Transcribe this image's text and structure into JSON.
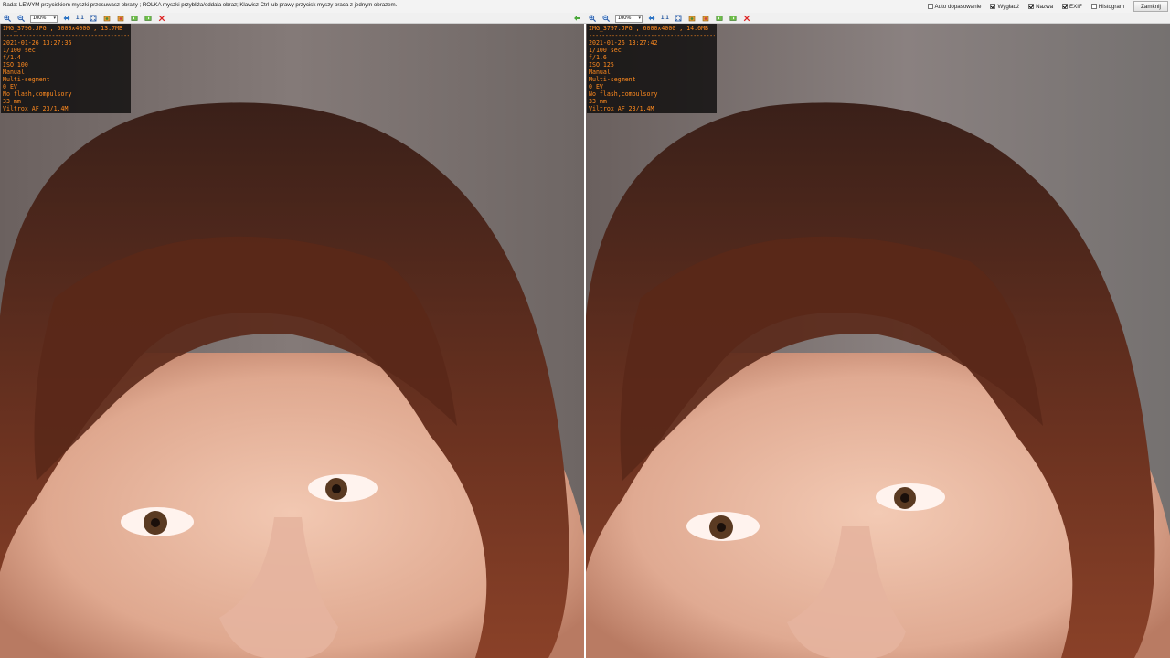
{
  "topbar": {
    "hint": "Rada: LEWYM przyciskiem myszki przesuwasz obrazy ; ROLKA myszki przybliża/oddala obraz; Klawisz Ctrl lub prawy przycisk myszy praca z jednym obrazem.",
    "options": [
      {
        "label": "Auto dopasowanie",
        "checked": false
      },
      {
        "label": "Wygładź",
        "checked": true
      },
      {
        "label": "Nazwa",
        "checked": true
      },
      {
        "label": "EXIF",
        "checked": true
      },
      {
        "label": "Histogram",
        "checked": false
      }
    ],
    "close_label": "Zamknij"
  },
  "panes": [
    {
      "zoom": "100%",
      "one_to_one": "1:1",
      "filename_line": "IMG_3796.JPG , 6000x4000 , 13.7MB",
      "separator": "--------------------------------------------",
      "exif": [
        "2021-01-26 13:27:36",
        "1/100 sec",
        "f/1.4",
        "ISO 100",
        "Manual",
        "Multi-segment",
        "0 EV",
        "No flash,compulsory",
        "33 mm",
        "Viltrox AF 23/1.4M"
      ]
    },
    {
      "zoom": "100%",
      "one_to_one": "1:1",
      "filename_line": "IMG_3797.JPG , 6000x4000 , 14.6MB",
      "separator": "--------------------------------------------",
      "exif": [
        "2021-01-26 13:27:42",
        "1/100 sec",
        "f/1.6",
        "ISO 125",
        "Manual",
        "Multi-segment",
        "0 EV",
        "No flash,compulsory",
        "33 mm",
        "Viltrox AF 23/1.4M"
      ]
    }
  ],
  "colors": {
    "exif_text": "#ff8a1f",
    "hair": "#6b2f1c",
    "skin": "#e7b8a2",
    "background": "#7a7270"
  },
  "icons": [
    "zoom-in-icon",
    "zoom-out-icon",
    "fit-icon",
    "actual-size-icon",
    "rotate-left-icon",
    "rotate-right-icon",
    "prev-image-icon",
    "next-image-icon",
    "close-icon",
    "sync-left-arrow-icon"
  ]
}
